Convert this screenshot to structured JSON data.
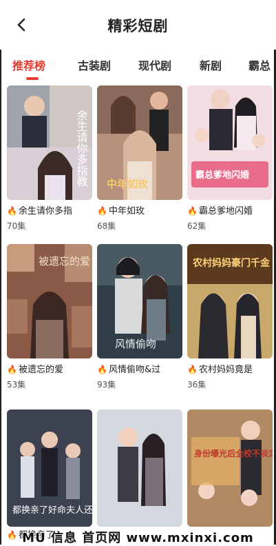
{
  "header": {
    "title": "精彩短剧",
    "back_icon": "chevron-left-icon"
  },
  "tabs": [
    {
      "label": "推荐榜",
      "active": true
    },
    {
      "label": "古装剧",
      "active": false
    },
    {
      "label": "现代剧",
      "active": false
    },
    {
      "label": "新剧",
      "active": false
    },
    {
      "label": "霸总",
      "active": false
    }
  ],
  "dramas": [
    {
      "title": "余生请你多指",
      "episodes": "70集",
      "poster_text": "余生请你多指教"
    },
    {
      "title": "中年如玫",
      "episodes": "68集",
      "poster_text": "中年如玫"
    },
    {
      "title": "霸总爹地闪婚",
      "episodes": "62集",
      "poster_text": "霸总爹地闪婚"
    },
    {
      "title": "被遗忘的爱",
      "episodes": "53集",
      "poster_text": "被遗忘的爱"
    },
    {
      "title": "风情偷吻&过",
      "episodes": "93集",
      "poster_text": "风情偷吻"
    },
    {
      "title": "农村妈妈竟是",
      "episodes": "36集",
      "poster_text": "农村妈妈豪门千金"
    },
    {
      "title": "都换亲了",
      "episodes": "",
      "poster_text": "都换亲了好命夫人还是我"
    },
    {
      "title": "",
      "episodes": "",
      "poster_text": ""
    },
    {
      "title": "",
      "episodes": "",
      "poster_text": "身份曝光后全校不淡定了"
    }
  ],
  "watermark": "MU 信息 首页网 www.mxinxi.com",
  "colors": {
    "accent": "#e63b2e",
    "fire": "#ff6a1a"
  }
}
